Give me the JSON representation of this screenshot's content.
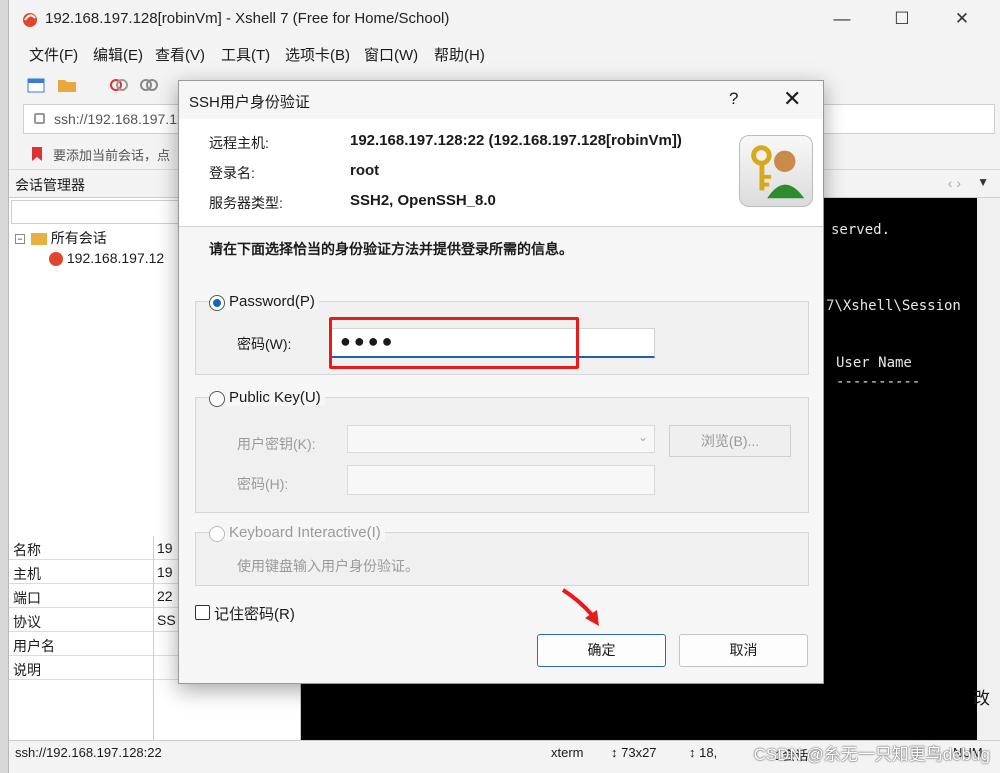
{
  "window": {
    "title": "192.168.197.128[robinVm] - Xshell 7 (Free for Home/School)",
    "controls": {
      "minimize": "—",
      "maximize": "☐",
      "close": "✕"
    }
  },
  "menu": [
    "文件(F)",
    "编辑(E)",
    "查看(V)",
    "工具(T)",
    "选项卡(B)",
    "窗口(W)",
    "帮助(H)"
  ],
  "address": {
    "value": "ssh://192.168.197.12"
  },
  "hint": {
    "text": "要添加当前会话，点"
  },
  "session_manager": {
    "title": "会话管理器",
    "tree": [
      {
        "label": "所有会话",
        "level": 0
      },
      {
        "label": "192.168.197.12",
        "level": 1
      }
    ],
    "properties": [
      {
        "key": "名称",
        "value": "19"
      },
      {
        "key": "主机",
        "value": "19"
      },
      {
        "key": "端口",
        "value": "22"
      },
      {
        "key": "协议",
        "value": "SS"
      },
      {
        "key": "用户名",
        "value": ""
      },
      {
        "key": "说明",
        "value": ""
      }
    ]
  },
  "terminal": {
    "lines": [
      "served.",
      "7\\Xshell\\Session",
      "User Name",
      "----------"
    ],
    "edge_char": "改"
  },
  "status": {
    "address": "ssh://192.168.197.128:22",
    "term": "xterm",
    "size": "↕ 73x27",
    "pos": "↕ 18,",
    "sessions": "1会话",
    "num": "NUM"
  },
  "watermark": "CSDN @糸无一只知更鸟debug",
  "dialog": {
    "title": "SSH用户身份验证",
    "help": "?",
    "close": "✕",
    "info": [
      {
        "key": "远程主机:",
        "value": "192.168.197.128:22 (192.168.197.128[robinVm])"
      },
      {
        "key": "登录名:",
        "value": "root"
      },
      {
        "key": "服务器类型:",
        "value": "SSH2, OpenSSH_8.0"
      }
    ],
    "instruction": "请在下面选择恰当的身份验证方法并提供登录所需的信息。",
    "password": {
      "label": "Password(P)",
      "field_label": "密码(W):",
      "value": "●●●●"
    },
    "publickey": {
      "label": "Public Key(U)",
      "user_key_label": "用户密钥(K):",
      "browse": "浏览(B)...",
      "passphrase_label": "密码(H):"
    },
    "keyboard": {
      "label": "Keyboard Interactive(I)",
      "desc": "使用键盘输入用户身份验证。"
    },
    "remember": "记住密码(R)",
    "ok": "确定",
    "cancel": "取消"
  }
}
